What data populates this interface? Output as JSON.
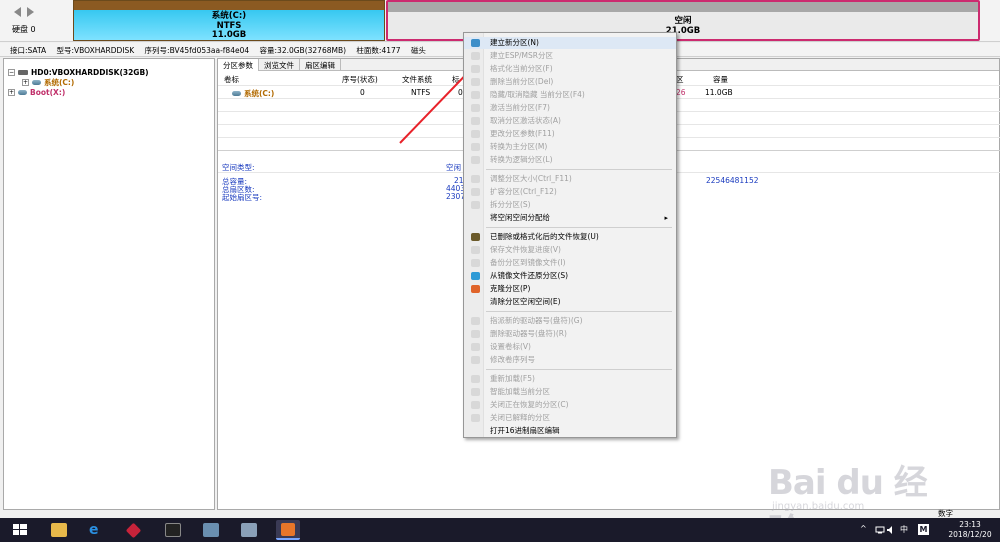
{
  "top": {
    "disk_label": "硬盘 0",
    "system_partition": {
      "name": "系统(C:)",
      "fs": "NTFS",
      "size": "11.0GB"
    },
    "free_partition": {
      "name": "空闲",
      "size": "21.0GB"
    }
  },
  "infobar": {
    "interface": "接口:SATA",
    "model": "型号:VBOXHARDDISK",
    "serial": "序列号:BV45fd053aa-f84e04",
    "capacity": "容量:32.0GB(32768MB)",
    "cylinders": "柱面数:4177",
    "heads": "磁头"
  },
  "tree": {
    "disk": "HD0:VBOXHARDDISK(32GB)",
    "items": [
      "系统(C:)",
      "Boot(X:)"
    ]
  },
  "tabs": [
    "分区参数",
    "浏览文件",
    "扇区编辑"
  ],
  "table": {
    "headers": {
      "label": "卷标",
      "seq": "序号(状态)",
      "fs": "文件系统",
      "trunc": "标",
      "id": "区",
      "capacity": "容量"
    },
    "row": {
      "label": "系统(C:)",
      "seq": "0",
      "fs": "NTFS",
      "trunc": "0",
      "id": "26",
      "capacity": "11.0GB"
    }
  },
  "details": {
    "type_label": "空间类型:",
    "type_value": "空闲",
    "total_capacity_label": "总容量:",
    "total_sectors_label": "总扇区数:",
    "start_sector_label": "起始扇区号:",
    "total_capacity_value": "21",
    "total_sectors_value": "4403",
    "start_sector_value": "2307",
    "right_value": "22546481152"
  },
  "menu": {
    "items": [
      {
        "label": "建立新分区(N)",
        "enabled": true,
        "highlight": true,
        "icon_color": "#3c8ec9"
      },
      {
        "label": "建立ESP/MSR分区",
        "enabled": false
      },
      {
        "label": "格式化当前分区(F)",
        "enabled": false
      },
      {
        "label": "删除当前分区(Del)",
        "enabled": false
      },
      {
        "label": "隐藏/取消隐藏 当前分区(F4)",
        "enabled": false
      },
      {
        "label": "激活当前分区(F7)",
        "enabled": false
      },
      {
        "label": "取消分区激活状态(A)",
        "enabled": false
      },
      {
        "label": "更改分区参数(F11)",
        "enabled": false
      },
      {
        "label": "转换为主分区(M)",
        "enabled": false
      },
      {
        "label": "转换为逻辑分区(L)",
        "enabled": false
      },
      {
        "label": "调整分区大小(Ctrl_F11)",
        "enabled": false
      },
      {
        "label": "扩容分区(Ctrl_F12)",
        "enabled": false
      },
      {
        "label": "拆分分区(S)",
        "enabled": false
      },
      {
        "label": "将空闲空间分配给",
        "enabled": true,
        "submenu": true
      },
      {
        "label": "已删除或格式化后的文件恢复(U)",
        "enabled": true,
        "icon_color": "#6b5a2a"
      },
      {
        "label": "保存文件恢复进度(V)",
        "enabled": false
      },
      {
        "label": "备份分区到镜像文件(I)",
        "enabled": false
      },
      {
        "label": "从镜像文件还原分区(S)",
        "enabled": true,
        "icon_color": "#2d9ad6"
      },
      {
        "label": "克隆分区(P)",
        "enabled": true,
        "icon_color": "#e0642a"
      },
      {
        "label": "清除分区空闲空间(E)",
        "enabled": true
      },
      {
        "label": "指派新的驱动器号(盘符)(G)",
        "enabled": false
      },
      {
        "label": "删除驱动器号(盘符)(R)",
        "enabled": false
      },
      {
        "label": "设置卷标(V)",
        "enabled": false
      },
      {
        "label": "修改卷序列号",
        "enabled": false
      },
      {
        "label": "重新加载(F5)",
        "enabled": false
      },
      {
        "label": "智能加载当前分区",
        "enabled": false
      },
      {
        "label": "关闭正在恢复的分区(C)",
        "enabled": false
      },
      {
        "label": "关闭已解释的分区",
        "enabled": false
      },
      {
        "label": "打开16进制扇区编辑",
        "enabled": true
      }
    ]
  },
  "status": {
    "text": "数字"
  },
  "taskbar": {
    "tray": {
      "chevron": "^",
      "ime": "中",
      "ime2": "M"
    },
    "time": "23:13",
    "date": "2018/12/20"
  },
  "watermark": {
    "big": "Bai du 经验",
    "small": "jingyan.baidu.com"
  },
  "colors": {
    "system_partition": "#37c8f0",
    "free_border": "#cc2a6f",
    "arrow": "#e8222a",
    "menu_highlight": "#dde8f5"
  }
}
